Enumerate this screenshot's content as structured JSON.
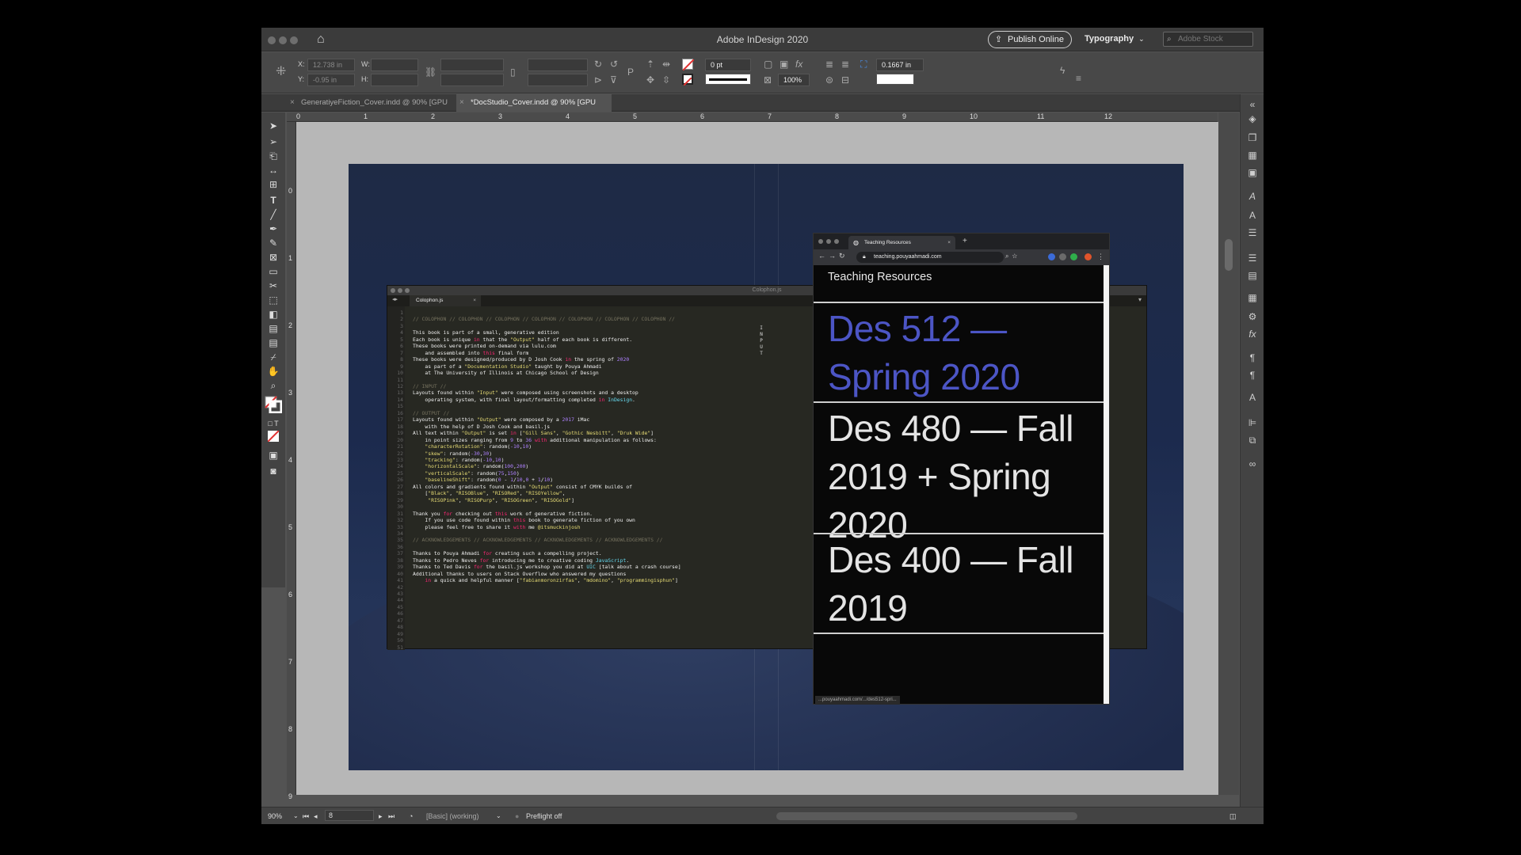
{
  "app": {
    "title": "Adobe InDesign 2020",
    "publish_label": "Publish Online",
    "workspace": "Typography",
    "stock_placeholder": "Adobe Stock"
  },
  "controlbar": {
    "x_label": "X:",
    "x_value": "12.738 in",
    "y_label": "Y:",
    "y_value": "-0.95 in",
    "w_label": "W:",
    "h_label": "H:",
    "stroke_weight": "0 pt",
    "scale": "100%",
    "offset": "0.1667 in"
  },
  "tabs": [
    {
      "label": "GeneratiyeFiction_Cover.indd @ 90% [GPU Preview]",
      "active": false
    },
    {
      "label": "*DocStudio_Cover.indd @ 90% [GPU Preview]",
      "active": true
    }
  ],
  "ruler": {
    "top": [
      "0",
      "1",
      "2",
      "3",
      "4",
      "5",
      "6",
      "7",
      "8",
      "9",
      "10",
      "11",
      "12"
    ],
    "left": [
      "0",
      "1",
      "2",
      "3",
      "4",
      "5",
      "6",
      "7",
      "8",
      "9"
    ]
  },
  "editor": {
    "window_title": "Colophon.js",
    "tab_label": "Colophon.js",
    "side_text": "INPUT"
  },
  "browser": {
    "tab_title": "Teaching Resources",
    "url": "teaching.pouyaahmadi.com",
    "site_title": "Teaching Resources",
    "courses": [
      {
        "label": "Des 512 — Spring 2020",
        "selected": true
      },
      {
        "label": "Des 480 — Fall 2019 + Spring 2020",
        "selected": false
      },
      {
        "label": "Des 400 — Fall 2019",
        "selected": false
      }
    ],
    "status_url": "...pouyaahmadi.com/.../des512-spri...",
    "accent_color": "#4c55c5"
  },
  "statusbar": {
    "zoom": "90%",
    "page": "8",
    "style": "[Basic] (working)",
    "preflight": "Preflight off"
  }
}
